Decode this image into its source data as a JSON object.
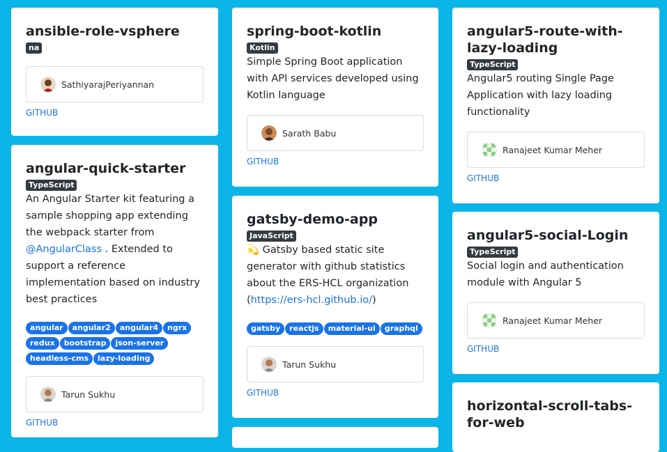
{
  "cards": [
    {
      "title": "ansible-role-vsphere",
      "language": "na",
      "owner": "SathiyarajPeriyannan",
      "link": "GITHUB"
    },
    {
      "title": "angular-quick-starter",
      "language": "TypeScript",
      "desc_before_link": "An Angular Starter kit featuring a sample shopping app extending the webpack starter from ",
      "desc_link": "@AngularClass",
      "desc_after_link": " . Extended to support a reference implementation based on industry best practices",
      "tags": [
        "angular",
        "angular2",
        "angular4",
        "ngrx",
        "redux",
        "bootstrap",
        "json-server",
        "headless-cms",
        "lazy-loading"
      ],
      "owner": "Tarun Sukhu",
      "link": "GITHUB"
    },
    {
      "title": "spring-boot-kotlin",
      "language": "Kotlin",
      "desc": "Simple Spring Boot application with API services developed using Kotlin language",
      "owner": "Sarath Babu",
      "link": "GITHUB"
    },
    {
      "title": "gatsby-demo-app",
      "language": "JavaScript",
      "desc_before_link": "💫 Gatsby based static site generator with github statistics about the ERS-HCL organization (",
      "desc_link": "https://ers-hcl.github.io/",
      "desc_after_link": ")",
      "tags": [
        "gatsby",
        "reactjs",
        "material-ui",
        "graphql"
      ],
      "owner": "Tarun Sukhu",
      "link": "GITHUB"
    },
    {
      "title": "angular5-route-with-lazy-loading",
      "language": "TypeScript",
      "desc": "Angular5 routing Single Page Application with lazy loading functionality",
      "owner": "Ranajeet Kumar Meher",
      "link": "GITHUB"
    },
    {
      "title": "angular5-social-Login",
      "language": "TypeScript",
      "desc": "Social login and authentication module with Angular 5",
      "owner": "Ranajeet Kumar Meher",
      "link": "GITHUB"
    },
    {
      "title": "horizontal-scroll-tabs-for-web"
    }
  ],
  "colors": {
    "background": "#0bb5e8",
    "tag": "#1a73e8",
    "language_badge": "#343a40",
    "link": "#1a73e8"
  }
}
